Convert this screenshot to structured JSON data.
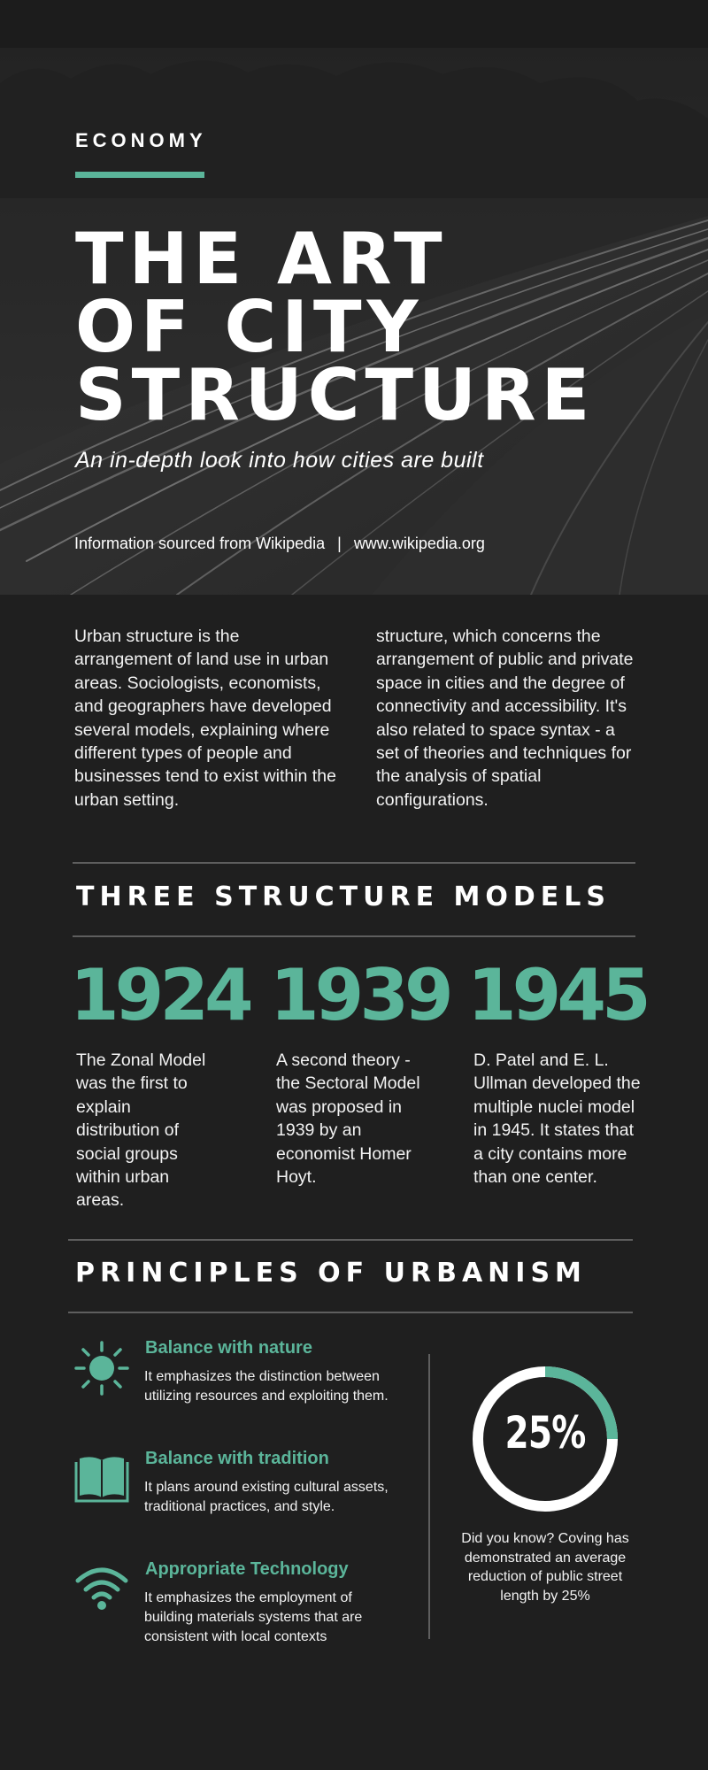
{
  "hero": {
    "category": "ECONOMY",
    "title_lines": [
      "THE ART",
      "OF CITY",
      "STRUCTURE"
    ],
    "subtitle": "An in-depth look into how cities are built",
    "source_label": "Information sourced from Wikipedia",
    "source_separator": "|",
    "source_url": "www.wikipedia.org"
  },
  "intro": {
    "left": "Urban structure is the arrangement of land use in urban areas. Sociologists, economists, and geographers have developed several models, explaining where different types of people and businesses tend to exist within the urban setting.",
    "right": "structure, which concerns the arrangement of public and private space in cities and the degree of connectivity and accessibility. It's also related to space syntax - a set of theories and techniques for the analysis of spatial configurations."
  },
  "models": {
    "title": "THREE STRUCTURE MODELS",
    "items": [
      {
        "year": "1924",
        "text": "The Zonal Model was the first to explain distribution of social groups within urban areas."
      },
      {
        "year": "1939",
        "text": "A second theory - the Sectoral Model was proposed in 1939 by an economist Homer Hoyt."
      },
      {
        "year": "1945",
        "text": "D. Patel and E. L. Ullman developed the multiple nuclei model in 1945. It states that a city contains more than one center."
      }
    ]
  },
  "principles": {
    "title": "PRINCIPLES OF URBANISM",
    "items": [
      {
        "icon": "sun-icon",
        "title": "Balance with nature",
        "text": "It emphasizes the distinction between utilizing resources and exploiting them."
      },
      {
        "icon": "book-icon",
        "title": "Balance with tradition",
        "text": "It plans around existing cultural assets, traditional practices, and style."
      },
      {
        "icon": "wifi-icon",
        "title": "Appropriate Technology",
        "text": "It emphasizes the employment of building materials systems that are consistent with local contexts"
      }
    ]
  },
  "stat": {
    "percent_label": "25%",
    "fraction": 0.25,
    "fact": "Did you know? Coving has demonstrated an average reduction of public street length by 25%"
  },
  "colors": {
    "accent": "#5bb59a",
    "background": "#1f1f1f",
    "text": "#ffffff"
  }
}
